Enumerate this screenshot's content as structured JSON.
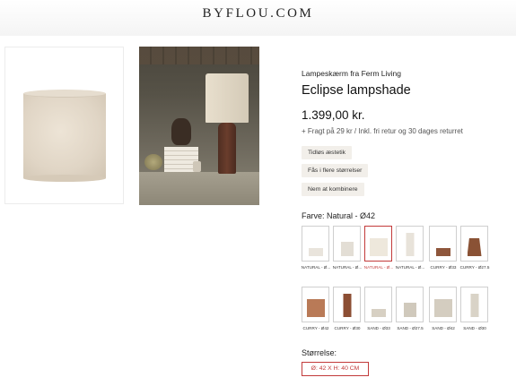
{
  "header": {
    "logo": "BYFLOU.COM"
  },
  "product": {
    "brand_line": "Lampeskærm fra Ferm Living",
    "title": "Eclipse lampshade",
    "price": "1.399,00 kr.",
    "shipping": "+ Fragt på 29 kr / Inkl. fri retur og 30 dages returret",
    "tags": [
      "Tidløs æstetik",
      "Fås i flere størrelser",
      "Nem at kombinere"
    ]
  },
  "color": {
    "label": "Farve: Natural - Ø42",
    "swatches": [
      {
        "label": "NATURAL - Ø...",
        "color": "#e9e4dc",
        "shape": "wide-low",
        "selected": false
      },
      {
        "label": "NATURAL - Ø...",
        "color": "#e3ded5",
        "shape": "mid",
        "selected": false
      },
      {
        "label": "NATURAL - Ø...",
        "color": "#eee8dc",
        "shape": "wide-tall",
        "selected": true
      },
      {
        "label": "NATURAL - Ø...",
        "color": "#e8e3da",
        "shape": "tall-thin",
        "selected": false
      },
      {
        "label": "CURRY - Ø33",
        "color": "#8e563b",
        "shape": "wide-low",
        "selected": false
      },
      {
        "label": "CURRY - Ø27.5",
        "color": "#8a5235",
        "shape": "cone",
        "selected": false
      },
      {
        "label": "CURRY - Ø42",
        "color": "#b97a57",
        "shape": "wide-tall",
        "selected": false
      },
      {
        "label": "CURRY - Ø30",
        "color": "#8c4e33",
        "shape": "tall-thin",
        "selected": false
      },
      {
        "label": "SAND - Ø33",
        "color": "#d7d0c3",
        "shape": "wide-low",
        "selected": false
      },
      {
        "label": "SAND - Ø27.5",
        "color": "#d0c9bc",
        "shape": "mid",
        "selected": false
      },
      {
        "label": "SAND - Ø42",
        "color": "#d4cdc0",
        "shape": "wide-tall",
        "selected": false
      },
      {
        "label": "SAND - Ø30",
        "color": "#d9d3c7",
        "shape": "tall-thin",
        "selected": false
      }
    ]
  },
  "size": {
    "label": "Størrelse:",
    "selected": "Ø: 42 X H: 40 CM"
  },
  "colors": {
    "accent": "#c23a3a",
    "tag_bg": "#f2efea"
  }
}
